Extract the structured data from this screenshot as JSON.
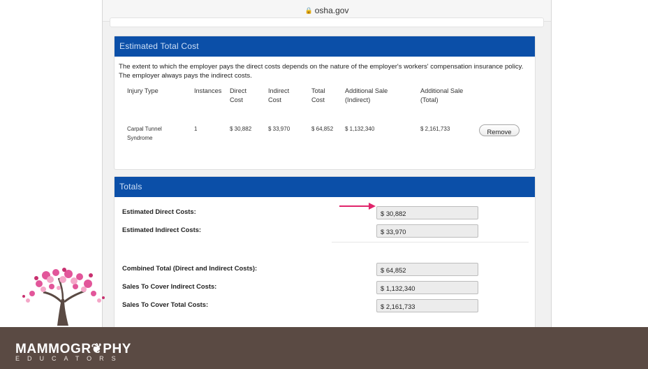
{
  "browser": {
    "url": "osha.gov"
  },
  "estimated": {
    "header": "Estimated Total Cost",
    "description": "The extent to which the employer pays the direct costs depends on the nature of the employer's workers' compensation insurance policy. The employer always pays the indirect costs.",
    "columns": [
      [
        "Injury Type",
        ""
      ],
      [
        "Instances",
        ""
      ],
      [
        "Direct",
        "Cost"
      ],
      [
        "Indirect",
        "Cost"
      ],
      [
        "Total",
        "Cost"
      ],
      [
        "Additional Sale",
        "(Indirect)"
      ],
      [
        "Additional Sale",
        "(Total)"
      ]
    ],
    "rows": [
      {
        "injury_type_1": "Carpal Tunnel",
        "injury_type_2": "Syndrome",
        "instances": "1",
        "direct": "$ 30,882",
        "indirect": "$ 33,970",
        "total": "$ 64,852",
        "sale_indirect": "$ 1,132,340",
        "sale_total": "$ 2,161,733",
        "remove_label": "Remove"
      }
    ]
  },
  "totals": {
    "header": "Totals",
    "items": [
      {
        "label": "Estimated Direct Costs:",
        "value": "$ 30,882"
      },
      {
        "label": "Estimated Indirect Costs:",
        "value": "$ 33,970"
      },
      {
        "label": "Combined Total (Direct and Indirect Costs):",
        "value": "$ 64,852"
      },
      {
        "label": "Sales To Cover Indirect Costs:",
        "value": "$ 1,132,340"
      },
      {
        "label": "Sales To Cover Total Costs:",
        "value": "$ 2,161,733"
      }
    ]
  },
  "brand": {
    "name": "MAMMOGR❦PHY",
    "sub": "EDUCATORS"
  },
  "colors": {
    "header_blue": "#0b4fa8",
    "arrow": "#e0256b",
    "band": "#5a4a43"
  }
}
